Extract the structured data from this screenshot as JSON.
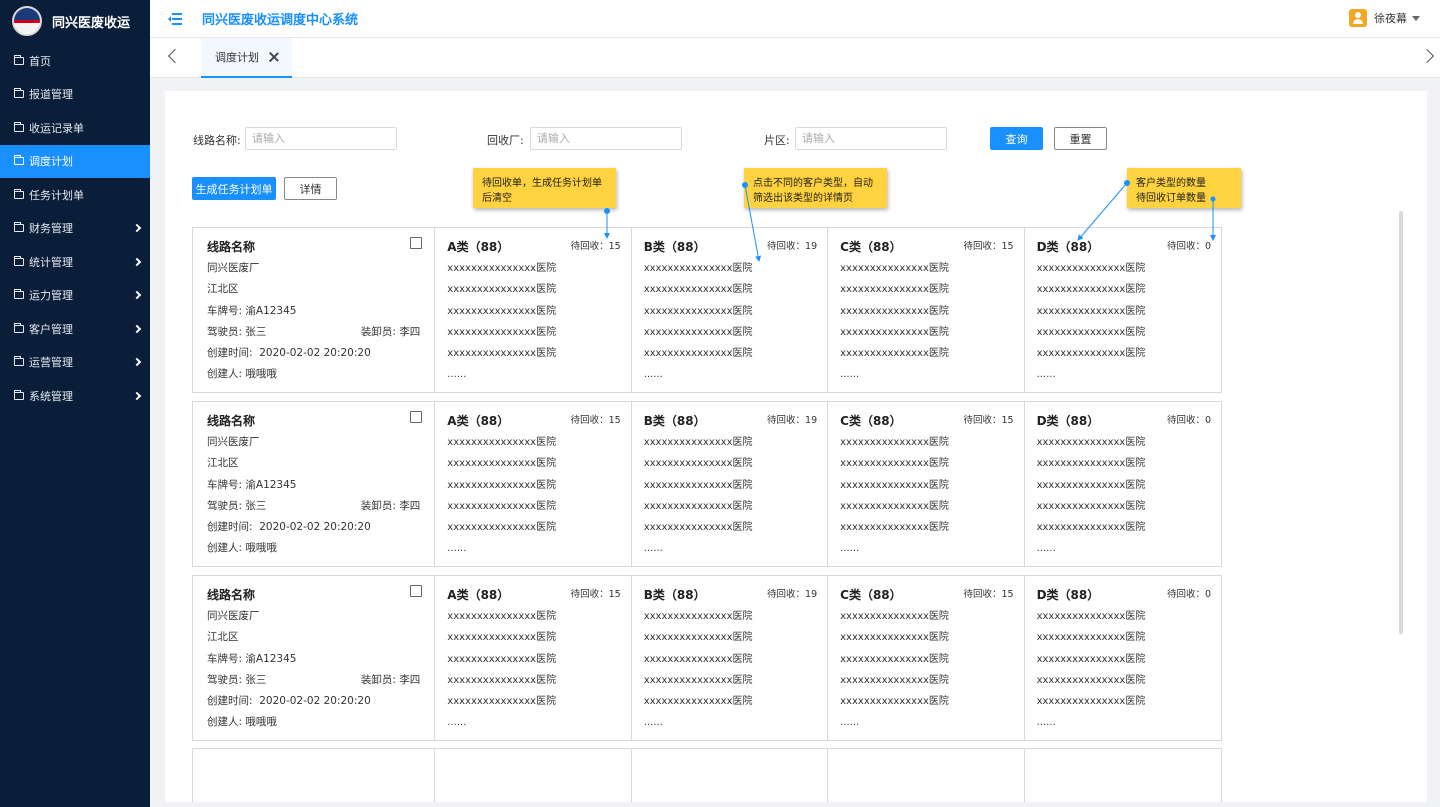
{
  "app": {
    "name": "同兴医废收运",
    "system_title": "同兴医废收运调度中心系统"
  },
  "user": {
    "name": "徐夜幕"
  },
  "sidebar": {
    "items": [
      {
        "label": "首页",
        "has_submenu": false,
        "active": false
      },
      {
        "label": "报道管理",
        "has_submenu": false,
        "active": false
      },
      {
        "label": "收运记录单",
        "has_submenu": false,
        "active": false
      },
      {
        "label": "调度计划",
        "has_submenu": false,
        "active": true
      },
      {
        "label": "任务计划单",
        "has_submenu": false,
        "active": false
      },
      {
        "label": "财务管理",
        "has_submenu": true,
        "active": false
      },
      {
        "label": "统计管理",
        "has_submenu": true,
        "active": false
      },
      {
        "label": "运力管理",
        "has_submenu": true,
        "active": false
      },
      {
        "label": "客户管理",
        "has_submenu": true,
        "active": false
      },
      {
        "label": "运营管理",
        "has_submenu": true,
        "active": false
      },
      {
        "label": "系统管理",
        "has_submenu": true,
        "active": false
      }
    ]
  },
  "tabs": [
    {
      "label": "调度计划"
    }
  ],
  "filters": {
    "route_label": "线路名称:",
    "recycle_label": "回收厂:",
    "area_label": "片区:",
    "placeholder": "请输入",
    "query_button": "查询",
    "reset_button": "重置"
  },
  "actions": {
    "generate_button": "生成任务计划单",
    "detail_button": "详情"
  },
  "notes": {
    "note1": "待回收单，生成任务计划单后清空",
    "note2": "点击不同的客户类型，自动筛选出该类型的详情页",
    "note3_line1": "客户类型的数量",
    "note3_line2": "待回收订单数量"
  },
  "cards": [
    {
      "title": "线路名称",
      "factory": "同兴医废厂",
      "district": "江北区",
      "plate_label": "车牌号:",
      "plate": "渝A12345",
      "driver_label": "驾驶员:",
      "driver": "张三",
      "loader_label": "装卸员:",
      "loader": "李四",
      "created_label": "创建时间:",
      "created": "2020-02-02 20:20:20",
      "creator_label": "创建人:",
      "creator": "哦哦哦",
      "categories": [
        {
          "title": "A类（88）",
          "pending": "待回收：15",
          "items": [
            "xxxxxxxxxxxxxxx医院",
            "xxxxxxxxxxxxxxx医院",
            "xxxxxxxxxxxxxxx医院",
            "xxxxxxxxxxxxxxx医院",
            "xxxxxxxxxxxxxxx医院",
            "......"
          ]
        },
        {
          "title": "B类（88）",
          "pending": "待回收：19",
          "items": [
            "xxxxxxxxxxxxxxx医院",
            "xxxxxxxxxxxxxxx医院",
            "xxxxxxxxxxxxxxx医院",
            "xxxxxxxxxxxxxxx医院",
            "xxxxxxxxxxxxxxx医院",
            "......"
          ]
        },
        {
          "title": "C类（88）",
          "pending": "待回收：15",
          "items": [
            "xxxxxxxxxxxxxxx医院",
            "xxxxxxxxxxxxxxx医院",
            "xxxxxxxxxxxxxxx医院",
            "xxxxxxxxxxxxxxx医院",
            "xxxxxxxxxxxxxxx医院",
            "......"
          ]
        },
        {
          "title": "D类（88）",
          "pending": "待回收：0",
          "items": [
            "xxxxxxxxxxxxxxx医院",
            "xxxxxxxxxxxxxxx医院",
            "xxxxxxxxxxxxxxx医院",
            "xxxxxxxxxxxxxxx医院",
            "xxxxxxxxxxxxxxx医院",
            "......"
          ]
        }
      ]
    },
    {
      "title": "线路名称",
      "factory": "同兴医废厂",
      "district": "江北区",
      "plate_label": "车牌号:",
      "plate": "渝A12345",
      "driver_label": "驾驶员:",
      "driver": "张三",
      "loader_label": "装卸员:",
      "loader": "李四",
      "created_label": "创建时间:",
      "created": "2020-02-02 20:20:20",
      "creator_label": "创建人:",
      "creator": "哦哦哦",
      "categories": [
        {
          "title": "A类（88）",
          "pending": "待回收：15",
          "items": [
            "xxxxxxxxxxxxxxx医院",
            "xxxxxxxxxxxxxxx医院",
            "xxxxxxxxxxxxxxx医院",
            "xxxxxxxxxxxxxxx医院",
            "xxxxxxxxxxxxxxx医院",
            "......"
          ]
        },
        {
          "title": "B类（88）",
          "pending": "待回收：19",
          "items": [
            "xxxxxxxxxxxxxxx医院",
            "xxxxxxxxxxxxxxx医院",
            "xxxxxxxxxxxxxxx医院",
            "xxxxxxxxxxxxxxx医院",
            "xxxxxxxxxxxxxxx医院",
            "......"
          ]
        },
        {
          "title": "C类（88）",
          "pending": "待回收：15",
          "items": [
            "xxxxxxxxxxxxxxx医院",
            "xxxxxxxxxxxxxxx医院",
            "xxxxxxxxxxxxxxx医院",
            "xxxxxxxxxxxxxxx医院",
            "xxxxxxxxxxxxxxx医院",
            "......"
          ]
        },
        {
          "title": "D类（88）",
          "pending": "待回收：0",
          "items": [
            "xxxxxxxxxxxxxxx医院",
            "xxxxxxxxxxxxxxx医院",
            "xxxxxxxxxxxxxxx医院",
            "xxxxxxxxxxxxxxx医院",
            "xxxxxxxxxxxxxxx医院",
            "......"
          ]
        }
      ]
    },
    {
      "title": "线路名称",
      "factory": "同兴医废厂",
      "district": "江北区",
      "plate_label": "车牌号:",
      "plate": "渝A12345",
      "driver_label": "驾驶员:",
      "driver": "张三",
      "loader_label": "装卸员:",
      "loader": "李四",
      "created_label": "创建时间:",
      "created": "2020-02-02 20:20:20",
      "creator_label": "创建人:",
      "creator": "哦哦哦",
      "categories": [
        {
          "title": "A类（88）",
          "pending": "待回收：15",
          "items": [
            "xxxxxxxxxxxxxxx医院",
            "xxxxxxxxxxxxxxx医院",
            "xxxxxxxxxxxxxxx医院",
            "xxxxxxxxxxxxxxx医院",
            "xxxxxxxxxxxxxxx医院",
            "......"
          ]
        },
        {
          "title": "B类（88）",
          "pending": "待回收：19",
          "items": [
            "xxxxxxxxxxxxxxx医院",
            "xxxxxxxxxxxxxxx医院",
            "xxxxxxxxxxxxxxx医院",
            "xxxxxxxxxxxxxxx医院",
            "xxxxxxxxxxxxxxx医院",
            "......"
          ]
        },
        {
          "title": "C类（88）",
          "pending": "待回收：15",
          "items": [
            "xxxxxxxxxxxxxxx医院",
            "xxxxxxxxxxxxxxx医院",
            "xxxxxxxxxxxxxxx医院",
            "xxxxxxxxxxxxxxx医院",
            "xxxxxxxxxxxxxxx医院",
            "......"
          ]
        },
        {
          "title": "D类（88）",
          "pending": "待回收：0",
          "items": [
            "xxxxxxxxxxxxxxx医院",
            "xxxxxxxxxxxxxxx医院",
            "xxxxxxxxxxxxxxx医院",
            "xxxxxxxxxxxxxxx医院",
            "xxxxxxxxxxxxxxx医院",
            "......"
          ]
        }
      ]
    }
  ],
  "colors": {
    "sidebar_bg": "#0a1e3a",
    "accent": "#1890ff",
    "note_bg": "#ffd23f"
  }
}
